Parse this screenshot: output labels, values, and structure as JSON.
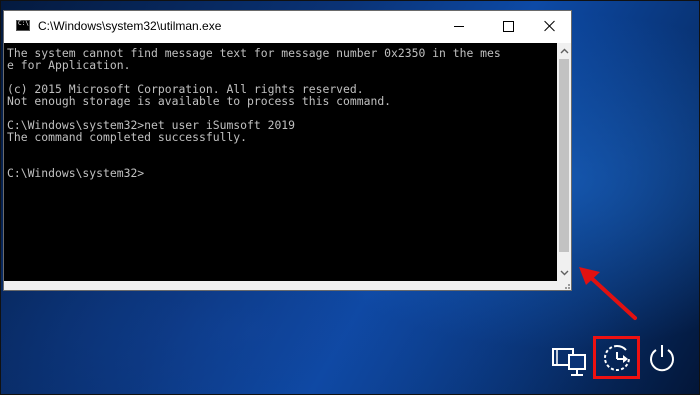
{
  "window": {
    "title": "C:\\Windows\\system32\\utilman.exe",
    "controls": {
      "minimize_icon": "minimize-icon",
      "maximize_icon": "maximize-icon",
      "close_icon": "close-icon"
    }
  },
  "console": {
    "lines": [
      "The system cannot find message text for message number 0x2350 in the mes",
      "e for Application.",
      "",
      "(c) 2015 Microsoft Corporation. All rights reserved.",
      "Not enough storage is available to process this command.",
      "",
      "C:\\Windows\\system32>net user iSumsoft 2019",
      "The command completed successfully.",
      "",
      "",
      "C:\\Windows\\system32>"
    ],
    "text_color": "#c0c0c0",
    "background": "#000000"
  },
  "tray": {
    "network_icon": "network-icon",
    "ease_of_access_icon": "ease-of-access-icon",
    "power_icon": "power-icon"
  },
  "annotation": {
    "color": "#e11111",
    "arrow_icon": "red-arrow-icon"
  }
}
